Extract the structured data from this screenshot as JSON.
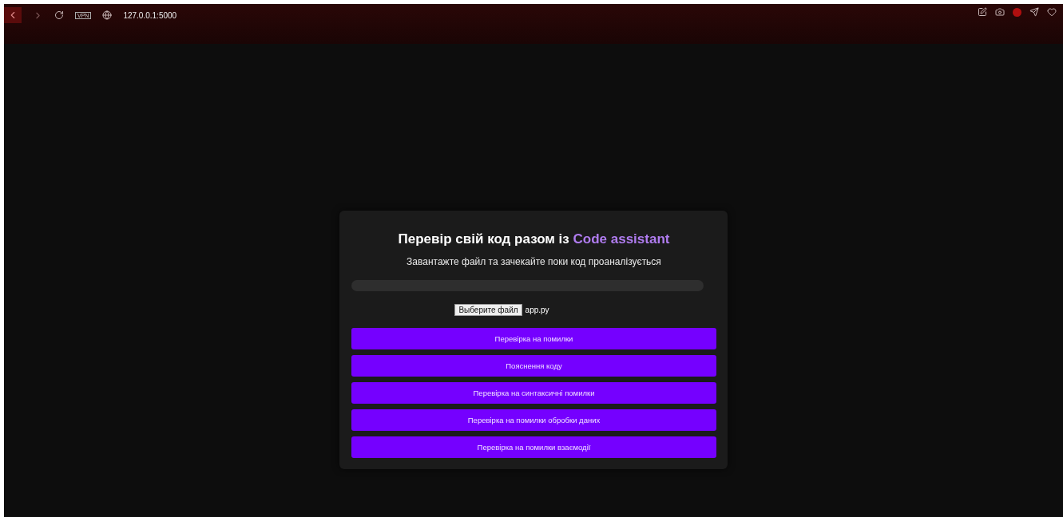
{
  "browser": {
    "vpn_badge": "VPN",
    "address": "127.0.0.1:5000"
  },
  "card": {
    "title": "Перевір свій код разом із",
    "title_highlight": "Code assistant",
    "subtitle": "Завантажте файл та зачекайте поки код проаналізується",
    "file": {
      "button": "Выберите файл",
      "name": "app.py"
    },
    "buttons": [
      "Перевірка на помилки",
      "Пояснення коду",
      "Перевірка на синтаксичні помилки",
      "Перевірка на помилки обробки даних",
      "Перевірка на помилки взаємодії"
    ]
  }
}
